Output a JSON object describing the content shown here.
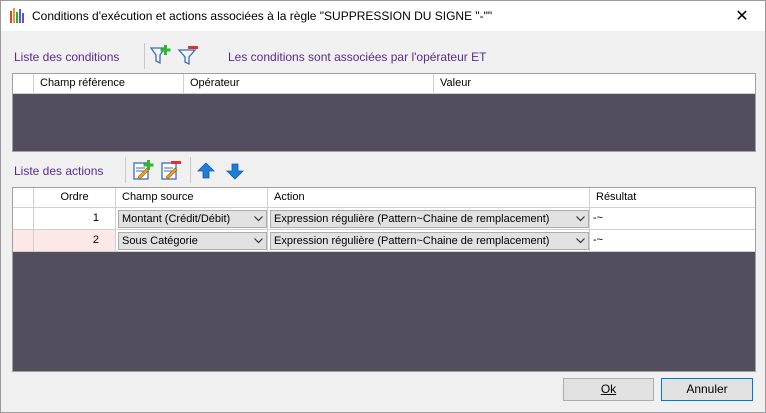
{
  "window": {
    "title": "Conditions d'exécution et actions associées à la règle \"SUPPRESSION DU SIGNE \"-\"\"",
    "close_glyph": "✕"
  },
  "conditions": {
    "label": "Liste des conditions",
    "note": "Les conditions sont associées par l'opérateur ET",
    "columns": [
      "Champ référence",
      "Opérateur",
      "Valeur"
    ],
    "rows": []
  },
  "actions": {
    "label": "Liste des actions",
    "columns": [
      "Ordre",
      "Champ source",
      "Action",
      "Résultat"
    ],
    "rows": [
      {
        "order": "1",
        "source": "Montant (Crédit/Débit)",
        "action": "Expression régulière (Pattern~Chaine de remplacement)",
        "result": "-~"
      },
      {
        "order": "2",
        "source": "Sous Catégorie",
        "action": "Expression régulière (Pattern~Chaine de remplacement)",
        "result": "-~"
      }
    ]
  },
  "buttons": {
    "ok": "Ok",
    "cancel": "Annuler"
  },
  "icons": {
    "app": "bar-chart-icon",
    "add_condition": "filter-add-icon",
    "delete_condition": "filter-delete-icon",
    "add_action": "edit-add-icon",
    "delete_action": "edit-delete-icon",
    "move_up": "arrow-up-icon",
    "move_down": "arrow-down-icon"
  },
  "colors": {
    "section_label": "#5a2b8c",
    "grid_bg": "#534d60",
    "arrow_blue": "#1e7fd8",
    "add_green": "#2eb82e",
    "delete_red": "#e03030"
  }
}
